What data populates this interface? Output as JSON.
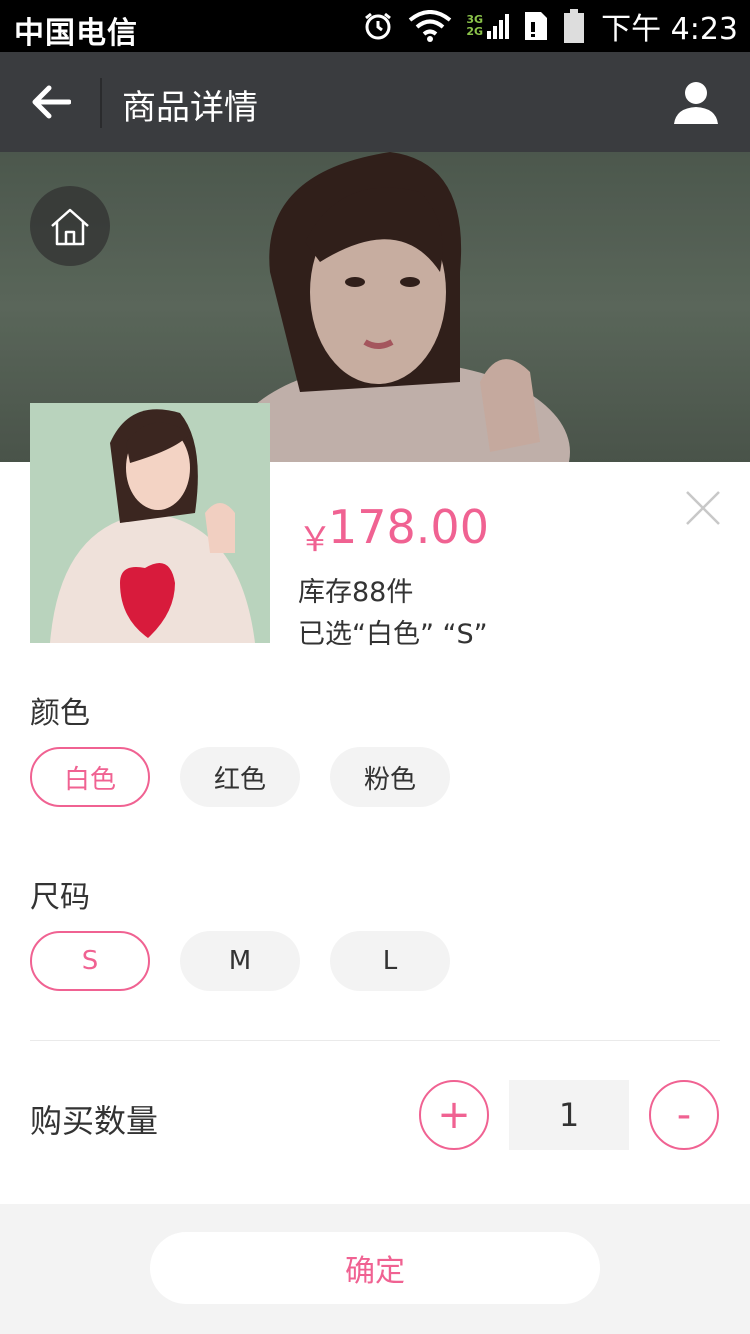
{
  "status_bar": {
    "carrier": "中国电信",
    "network_top": "3G",
    "network_bottom": "2G",
    "time": "下午 4:23",
    "icons": [
      "alarm-icon",
      "wifi-icon",
      "signal-icon",
      "sim-icon",
      "battery-icon"
    ]
  },
  "nav": {
    "title": "商品详情",
    "back_icon": "arrow-left-icon",
    "user_icon": "user-icon"
  },
  "hero": {
    "home_icon": "home-icon"
  },
  "product": {
    "price_symbol": "￥",
    "price": "178.00",
    "stock": "库存88件",
    "selected": "已选“白色”  “S”"
  },
  "color_section": {
    "title": "颜色",
    "options": [
      {
        "label": "白色",
        "active": true
      },
      {
        "label": "红色",
        "active": false
      },
      {
        "label": "粉色",
        "active": false
      }
    ]
  },
  "size_section": {
    "title": "尺码",
    "options": [
      {
        "label": "S",
        "active": true
      },
      {
        "label": "M",
        "active": false
      },
      {
        "label": "L",
        "active": false
      }
    ]
  },
  "quantity": {
    "label": "购买数量",
    "plus": "+",
    "value": "1",
    "minus": "-"
  },
  "footer": {
    "confirm_label": "确定"
  },
  "colors": {
    "accent": "#f06292",
    "nav_bg": "#3a3c3f",
    "chip_bg": "#f3f3f3"
  }
}
